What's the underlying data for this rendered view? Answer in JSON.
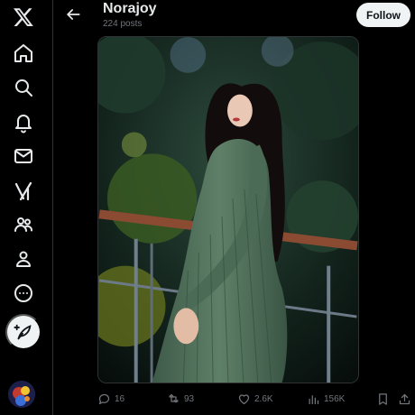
{
  "nav": {
    "items": [
      {
        "id": "x-logo",
        "icon": "x-logo-icon"
      },
      {
        "id": "home",
        "icon": "home-icon"
      },
      {
        "id": "explore",
        "icon": "search-icon"
      },
      {
        "id": "notifications",
        "icon": "bell-icon"
      },
      {
        "id": "messages",
        "icon": "mail-icon"
      },
      {
        "id": "grok",
        "icon": "grok-icon"
      },
      {
        "id": "communities",
        "icon": "people-icon"
      },
      {
        "id": "profile",
        "icon": "person-icon"
      },
      {
        "id": "more",
        "icon": "more-circle-icon"
      }
    ],
    "post_button_icon": "feather-plus-icon",
    "avatar_icon": "avatar-image"
  },
  "header": {
    "name": "Norajoy",
    "post_count": "224 posts",
    "follow_label": "Follow",
    "back_icon": "arrow-left-icon"
  },
  "media": {
    "kind": "photo",
    "content": "woman in green ribbed knit dress leaning on a railing outdoors"
  },
  "actions": {
    "replies": "16",
    "reposts": "93",
    "likes": "2.6K",
    "views": "156K"
  },
  "colors": {
    "background": "#000000",
    "text": "#e7e9ea",
    "muted": "#71767b",
    "border": "#2f3336",
    "follow_bg": "#eff3f4"
  }
}
